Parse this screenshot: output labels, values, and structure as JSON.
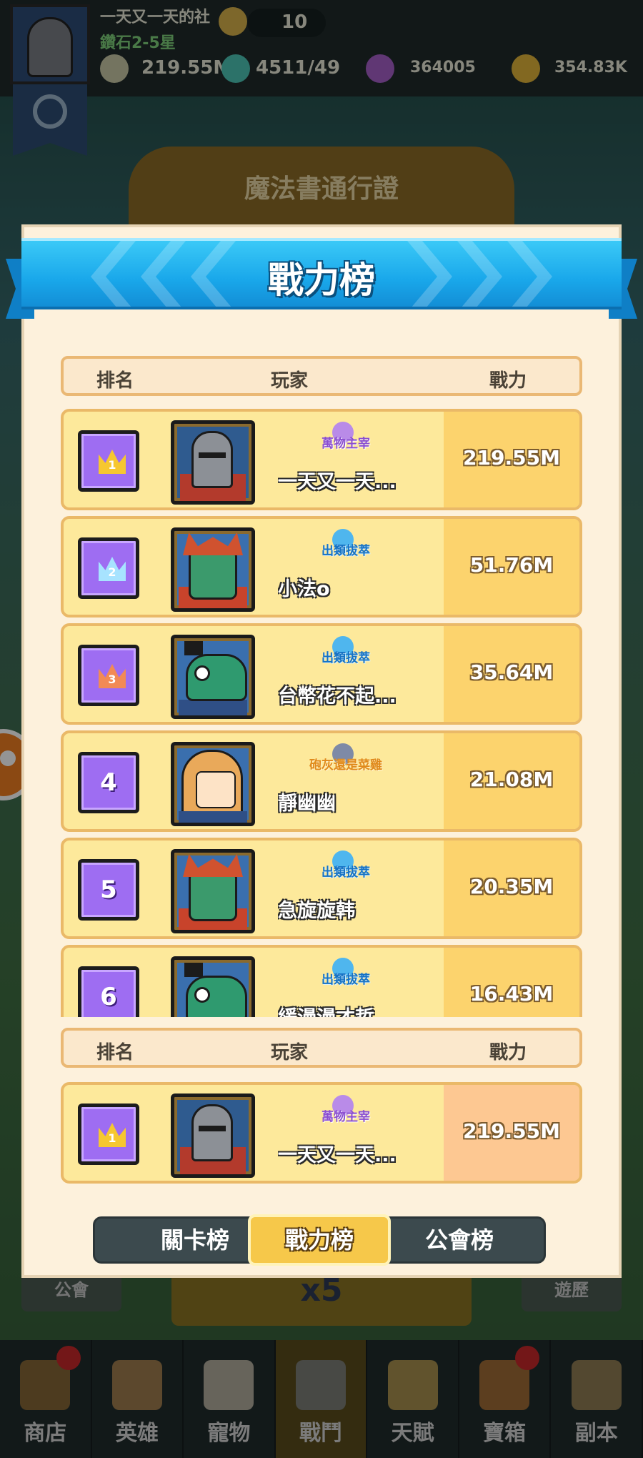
{
  "hud": {
    "player_name": "一天又一天的社",
    "rank_text": "鑽石2-5星",
    "energy": "10",
    "power": "219.55M",
    "stage_progress": "4511/49",
    "gems": "364005",
    "gold": "354.83K"
  },
  "background": {
    "title": "魔法書通行證",
    "left_button": "公會",
    "right_button": "遊歷",
    "center_button": "x5"
  },
  "modal": {
    "title": "戰力榜",
    "header": {
      "rank": "排名",
      "player": "玩家",
      "power": "戰力"
    },
    "rows": [
      {
        "rank": "1",
        "avatar": "knight-avatar",
        "title": "萬物主宰",
        "title_style": "purple",
        "name": "一天又一天...",
        "power": "219.55M"
      },
      {
        "rank": "2",
        "avatar": "dragon-avatar",
        "title": "出類拔萃",
        "title_style": "blue",
        "name": "小法o",
        "power": "51.76M"
      },
      {
        "rank": "3",
        "avatar": "dino-avatar",
        "title": "出類拔萃",
        "title_style": "blue",
        "name": "台幣花不起...",
        "power": "35.64M"
      },
      {
        "rank": "4",
        "avatar": "girl-avatar",
        "title": "砲灰還是菜雞",
        "title_style": "orange",
        "name": "靜幽幽",
        "power": "21.08M"
      },
      {
        "rank": "5",
        "avatar": "dragon-avatar",
        "title": "出類拔萃",
        "title_style": "blue",
        "name": "急旋旋韩",
        "power": "20.35M"
      },
      {
        "rank": "6",
        "avatar": "dino-avatar",
        "title": "出類拔萃",
        "title_style": "blue",
        "name": "緩漫漫才哲",
        "power": "16.43M"
      }
    ],
    "self_header": {
      "rank": "排名",
      "player": "玩家",
      "power": "戰力"
    },
    "self_row": {
      "rank": "1",
      "avatar": "knight-avatar",
      "title": "萬物主宰",
      "title_style": "purple",
      "name": "一天又一天...",
      "power": "219.55M"
    },
    "tabs": [
      {
        "label": "關卡榜",
        "active": false
      },
      {
        "label": "戰力榜",
        "active": true
      },
      {
        "label": "公會榜",
        "active": false
      }
    ]
  },
  "bottom_nav": [
    {
      "label": "商店",
      "icon": "shop-icon",
      "badge": true
    },
    {
      "label": "英雄",
      "icon": "hero-icon",
      "badge": false
    },
    {
      "label": "寵物",
      "icon": "pet-icon",
      "badge": false
    },
    {
      "label": "戰鬥",
      "icon": "swords-icon",
      "badge": false,
      "active": true
    },
    {
      "label": "天賦",
      "icon": "talent-icon",
      "badge": false
    },
    {
      "label": "寶箱",
      "icon": "chest-icon",
      "badge": true
    },
    {
      "label": "副本",
      "icon": "dungeon-icon",
      "badge": false
    }
  ],
  "colors": {
    "ribbon": "#19a7ea",
    "panel": "#fdf1dc",
    "row": "#fde99b",
    "power_cell": "#fcd36d",
    "rank_badge": "#9e6df2",
    "active_tab": "#f6c84a"
  }
}
